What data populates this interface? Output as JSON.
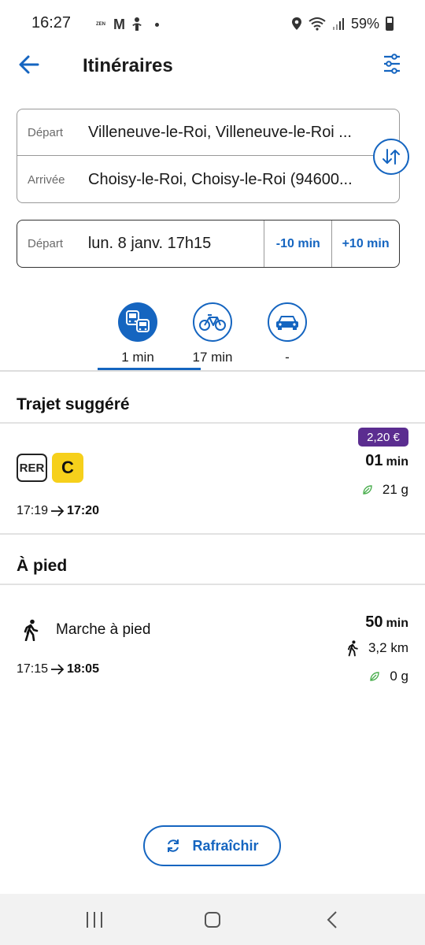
{
  "status_bar": {
    "time": "16:27",
    "zen_label": "ZEN",
    "gmail_label": "M",
    "battery": "59%"
  },
  "header": {
    "title": "Itinéraires",
    "back_icon": "arrow-left-icon",
    "filter_icon": "sliders-icon"
  },
  "route": {
    "departure_label": "Départ",
    "departure_value": "Villeneuve-le-Roi, Villeneuve-le-Roi ...",
    "arrival_label": "Arrivée",
    "arrival_value": "Choisy-le-Roi, Choisy-le-Roi (94600...",
    "swap_icon": "swap-vertical-icon"
  },
  "datetime": {
    "label": "Départ",
    "value": "lun. 8 janv. 17h15",
    "minus_label": "-10 min",
    "plus_label": "+10 min"
  },
  "modes": [
    {
      "icon": "public-transport-icon",
      "time": "1 min",
      "active": true
    },
    {
      "icon": "bike-icon",
      "time": "17 min",
      "active": false
    },
    {
      "icon": "car-icon",
      "time": "-",
      "active": false
    }
  ],
  "suggested": {
    "title": "Trajet suggéré",
    "rer_label": "RER",
    "line_label": "C",
    "price": "2,20 €",
    "duration_value": "01",
    "duration_unit": "min",
    "co2": "21 g",
    "departure_time": "17:19",
    "arrival_time": "17:20"
  },
  "walk": {
    "title": "À pied",
    "label": "Marche à pied",
    "duration_value": "50",
    "duration_unit": "min",
    "distance": "3,2 km",
    "co2": "0 g",
    "departure_time": "17:15",
    "arrival_time": "18:05"
  },
  "refresh": {
    "label": "Rafraîchir"
  },
  "colors": {
    "accent": "#1565c0",
    "line_c": "#f6d01b",
    "price_badge": "#5b2d90",
    "leaf": "#4caf50"
  }
}
